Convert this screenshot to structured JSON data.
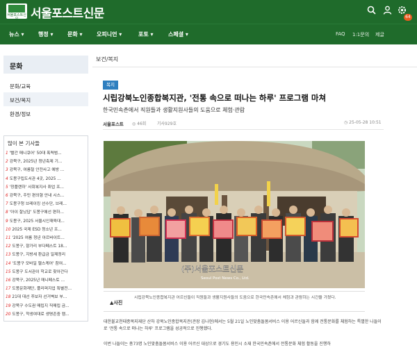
{
  "header": {
    "logo_text": "서울포스트신문",
    "brand": "서울포스트신문",
    "notification_count": "64"
  },
  "nav": {
    "items": [
      "뉴스 ▾",
      "행정 ▾",
      "문화 ▾",
      "오피니언 ▾",
      "포토 ▾",
      "스페셜 ▾"
    ],
    "sub": [
      "FAQ",
      "1:1문의",
      "제글"
    ]
  },
  "sidebar": {
    "category_title": "문화",
    "categories": [
      "문화/교육",
      "보건/복지",
      "환경/정보"
    ],
    "active_index": 1,
    "popular_title": "많이 본 기사들",
    "popular": [
      {
        "num": "1",
        "text": "'빨간 매니큐어' 50대 폭력범..."
      },
      {
        "num": "2",
        "text": "강북구, 2025년 청년축제 기..."
      },
      {
        "num": "3",
        "text": "강북구, 여름철 안전사고 예방 ..."
      },
      {
        "num": "4",
        "text": "도봉구립도서관 4곳, 2025 ..."
      },
      {
        "num": "5",
        "text": "'창플랜하' 사회복지사 취업 프..."
      },
      {
        "num": "6",
        "text": "강북구, 주민 편의형 안내 시스..."
      },
      {
        "num": "7",
        "text": "도봉구청 브레이킹 선수단, 브레..."
      },
      {
        "num": "8",
        "text": "'아이 잘났답' 도봉구에선 편하..."
      },
      {
        "num": "9",
        "text": "도봉구, 2025 서울시인재육대..."
      },
      {
        "num": "10",
        "text": "2025 국제 ESD 청소년 프..."
      },
      {
        "num": "11",
        "text": "'2025 여름 청년 아르바이트..."
      },
      {
        "num": "12",
        "text": "도봉구, 항가리 부다페스트 18..."
      },
      {
        "num": "13",
        "text": "도봉구, 지방세 환급금 일제정리"
      },
      {
        "num": "14",
        "text": "'도봉구 모바일 헬스케어' 참여..."
      },
      {
        "num": "15",
        "text": "도봉구 도서관이 학교로 찾아간다"
      },
      {
        "num": "16",
        "text": "강북구, 2025년 매니페스토 ..."
      },
      {
        "num": "17",
        "text": "도봉문화재단, 플리퍼지업 특별전..."
      },
      {
        "num": "18",
        "text": "21대 대선 후보자 선거벽보 부..."
      },
      {
        "num": "19",
        "text": "강북구 수도권 매립지 직매립 금..."
      },
      {
        "num": "20",
        "text": "도봉구, 학생여대로 생명존중 캠..."
      }
    ]
  },
  "article": {
    "breadcrumb": "보건/복지",
    "tag": "복지",
    "title": "시립강북노인종합복지관, '전통 속으로 떠나는 하루' 프로그램 마쳐",
    "subtitle": "한국민속촌에서 직원들과 생활지원사들의 도움으로 체험·관람",
    "author": "서울포스트",
    "views": "◎ 46회",
    "grid": "기사929호",
    "date": "◷ 25-05-28 10:51",
    "photo_watermark": "(주)서울포스트신문",
    "photo_watermark_en": "Seoul Post News Co., Ltd.",
    "caption_label": "▲사진",
    "caption": "시립강북노인종합복지관 어르신들이 직원들과 생활지원사들의 도움으로 한국민속촌에서 체험과 관람하는 시간을 가졌다.",
    "body_1": "대한불교천태종복지재단 산하 강북노인종합복지관(관장 김나현)에서는 5월 21일 노인맞춤돌봄서비스 이용 어르신들과 함께 전통문화를 체험하는 특별한 나들이로 '전통 속으로 떠나는 하루' 프로그램을 성공적으로 진행했다.",
    "body_2": "이번 나들이는 총73명 노인맞춤돌봄서비스 이용 어르신 대상으로 경기도 용인시 소재 한국민속촌에서 전통문화 체험 활동을 진행하"
  }
}
